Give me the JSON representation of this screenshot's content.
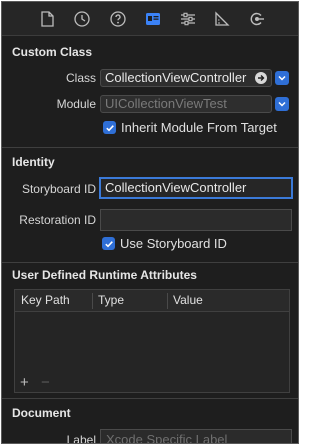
{
  "tabs": [
    {
      "name": "file-icon"
    },
    {
      "name": "history-icon"
    },
    {
      "name": "help-icon"
    },
    {
      "name": "identity-icon",
      "selected": true
    },
    {
      "name": "attributes-icon"
    },
    {
      "name": "size-icon"
    },
    {
      "name": "connections-icon"
    }
  ],
  "custom_class": {
    "title": "Custom Class",
    "class_label": "Class",
    "class_value": "CollectionViewController",
    "module_label": "Module",
    "module_placeholder": "UICollectionViewTest",
    "inherit_label": "Inherit Module From Target",
    "inherit_checked": true
  },
  "identity": {
    "title": "Identity",
    "storyboard_id_label": "Storyboard ID",
    "storyboard_id_value": "CollectionViewController",
    "restoration_id_label": "Restoration ID",
    "restoration_id_value": "",
    "use_storyboard_id_label": "Use Storyboard ID",
    "use_storyboard_id_checked": true
  },
  "runtime_attributes": {
    "title": "User Defined Runtime Attributes",
    "columns": [
      "Key Path",
      "Type",
      "Value"
    ],
    "add_label": "+",
    "remove_label": "−"
  },
  "document": {
    "title": "Document",
    "label_label": "Label",
    "label_placeholder": "Xcode Specific Label"
  },
  "colors": {
    "accent": "#2f6fd6",
    "background": "#1e1e1e"
  }
}
